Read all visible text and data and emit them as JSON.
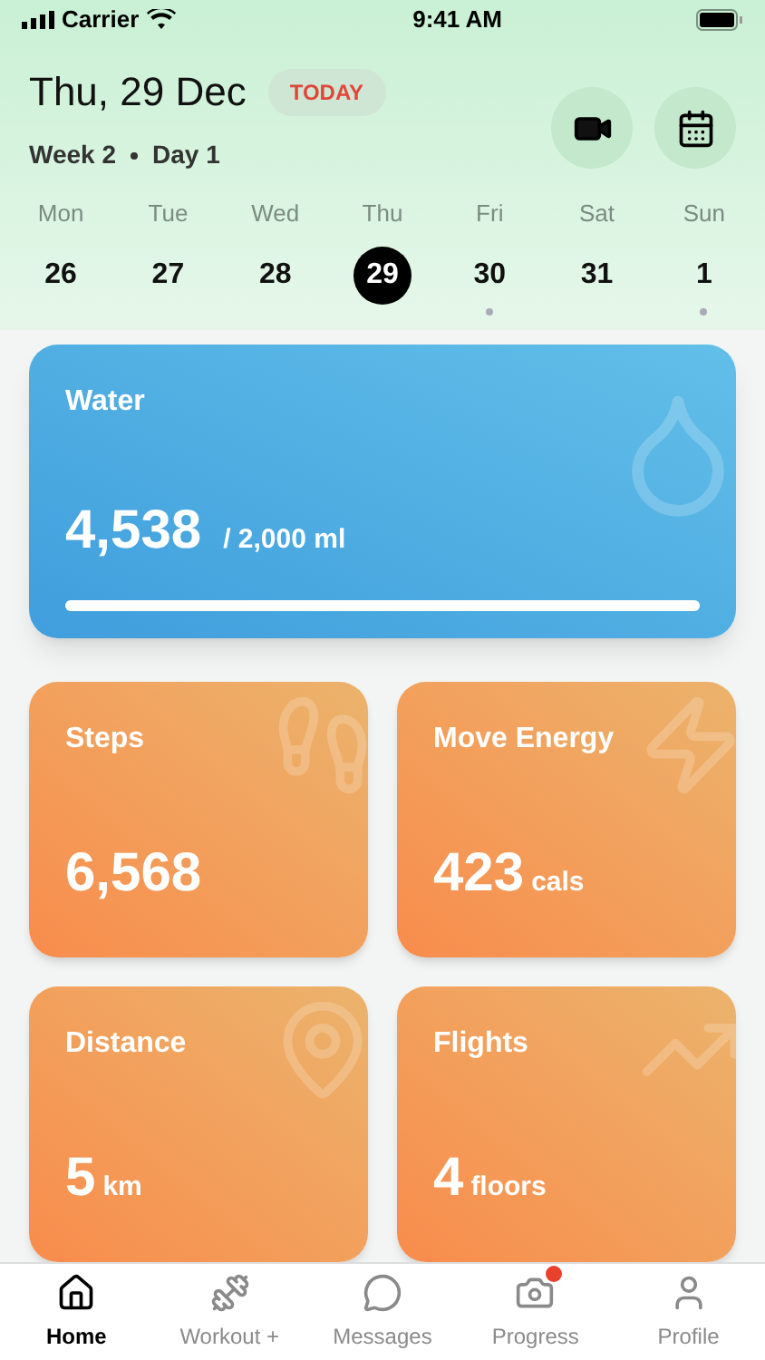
{
  "status_bar": {
    "carrier": "Carrier",
    "time": "9:41 AM"
  },
  "header": {
    "date": "Thu, 29 Dec",
    "badge": "TODAY",
    "week": "Week 2",
    "day": "Day 1"
  },
  "days": [
    {
      "weekday": "Mon",
      "date": "26",
      "selected": false,
      "dot": false
    },
    {
      "weekday": "Tue",
      "date": "27",
      "selected": false,
      "dot": false
    },
    {
      "weekday": "Wed",
      "date": "28",
      "selected": false,
      "dot": false
    },
    {
      "weekday": "Thu",
      "date": "29",
      "selected": true,
      "dot": false
    },
    {
      "weekday": "Fri",
      "date": "30",
      "selected": false,
      "dot": true
    },
    {
      "weekday": "Sat",
      "date": "31",
      "selected": false,
      "dot": false
    },
    {
      "weekday": "Sun",
      "date": "1",
      "selected": false,
      "dot": true
    }
  ],
  "water": {
    "title": "Water",
    "value": "4,538",
    "target": "/ 2,000 ml",
    "level": 1
  },
  "tiles": [
    {
      "kind": "steps",
      "title": "Steps",
      "value": "6,568"
    },
    {
      "kind": "energy",
      "title": "Move Energy",
      "value": "423",
      "unit": "cals"
    },
    {
      "kind": "distance",
      "title": "Distance",
      "value": "5",
      "unit": "km"
    },
    {
      "kind": "flights",
      "title": "Flights",
      "value": "4",
      "unit": "floors"
    }
  ],
  "tabs": [
    {
      "kind": "home",
      "label": "Home",
      "selected": true,
      "badge": false
    },
    {
      "kind": "workout",
      "label": "Workout +",
      "selected": false,
      "badge": false
    },
    {
      "kind": "messages",
      "label": "Messages",
      "selected": false,
      "badge": false
    },
    {
      "kind": "progress",
      "label": "Progress",
      "selected": false,
      "badge": true
    },
    {
      "kind": "profile",
      "label": "Profile",
      "selected": false,
      "badge": false
    }
  ]
}
